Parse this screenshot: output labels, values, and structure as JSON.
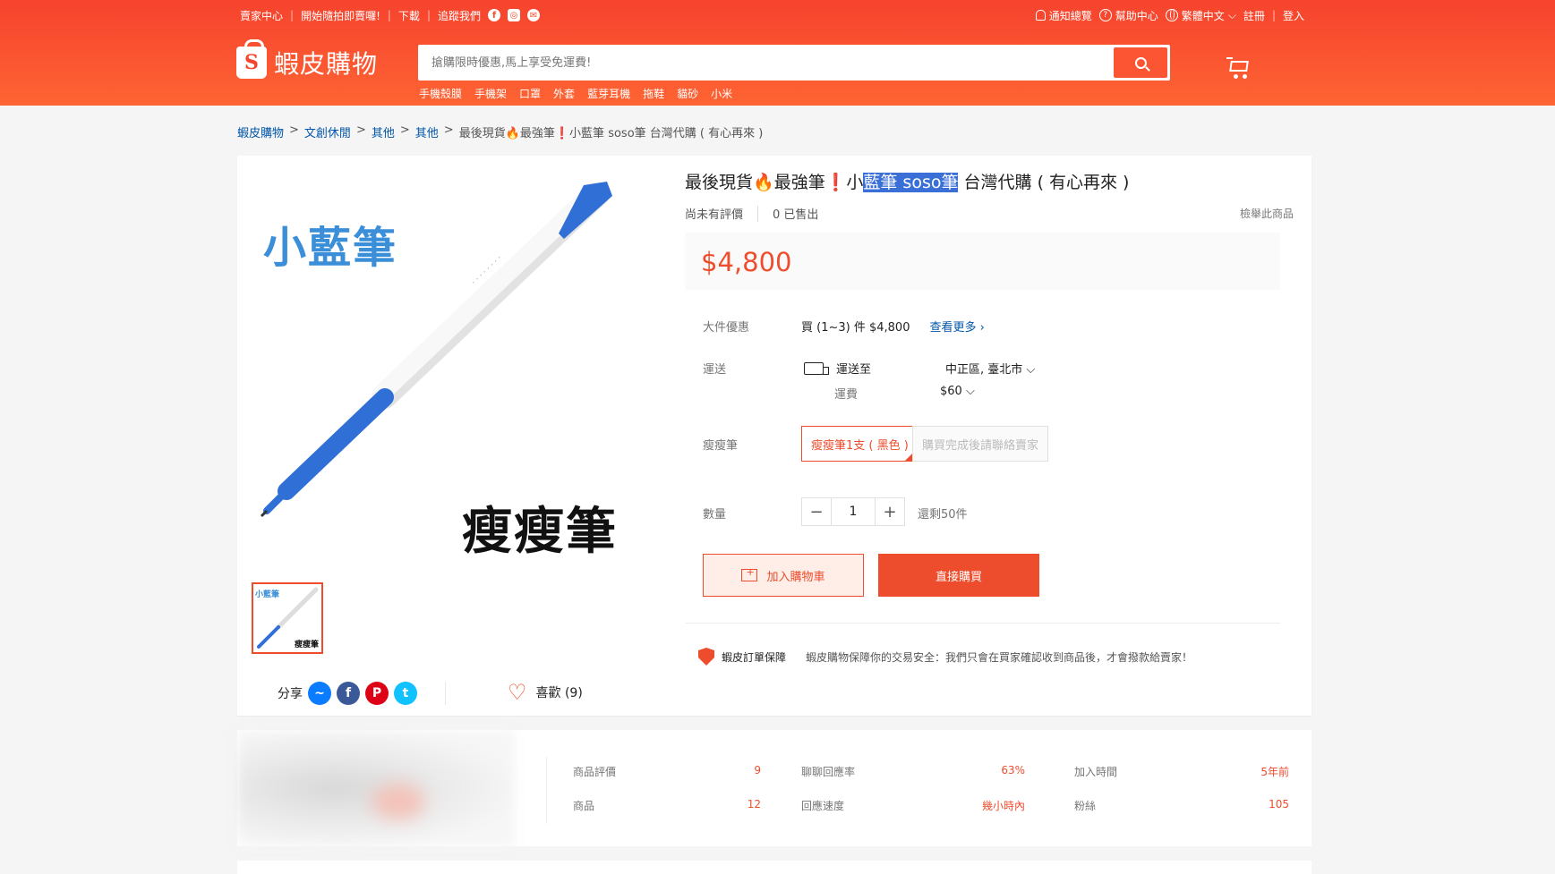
{
  "colors": {
    "brand": "#ee4d2d",
    "header": "#f6432e",
    "link": "#0055aa",
    "highlight": "#3b6fd8"
  },
  "topbar": {
    "left": [
      "賣家中心",
      "開始隨拍即賣囉!",
      "下載",
      "追蹤我們"
    ],
    "social": [
      "f",
      "◎",
      "✉"
    ],
    "right": [
      "通知總覽",
      "幫助中心",
      "繁體中文",
      "註冊",
      "登入"
    ]
  },
  "header": {
    "logo_text": "蝦皮購物",
    "search_placeholder": "搶購限時優惠,馬上享受免運費!",
    "hotwords": [
      "手機殼膜",
      "手機架",
      "口罩",
      "外套",
      "藍芽耳機",
      "拖鞋",
      "貓砂",
      "小米"
    ]
  },
  "breadcrumb": [
    "蝦皮購物",
    "文創休閒",
    "其他",
    "其他",
    "最後現貨🔥最強筆❗小藍筆 soso筆 台灣代購 ( 有心再來 )"
  ],
  "product": {
    "title_pre": "最後現貨",
    "title_flame": "🔥",
    "title_mid": "最強筆",
    "title_bang": "❗",
    "title_small": "小",
    "title_highlight": "藍筆 soso筆",
    "title_post": " 台灣代購 ( 有心再來 )",
    "rating": "尚未有評價",
    "sold": "0 已售出",
    "report": "檢舉此商品",
    "price": "$4,800",
    "image_caption_top": "小藍筆",
    "image_caption_bottom": "瘦瘦筆",
    "thumb_caption_top": "小藍筆",
    "thumb_caption_bottom": "瘦瘦筆"
  },
  "details": {
    "deal_label": "大件優惠",
    "deal_text": "買 (1~3) 件 $4,800",
    "deal_more": "查看更多 ›",
    "shipping_label": "運送",
    "shipping_to": "運送至",
    "shipping_dest": "中正區, 臺北市 ⌵",
    "shipping_fee_label": "運費",
    "shipping_fee": "$60 ⌵",
    "variant_label": "瘦瘦筆",
    "variant_selected": "瘦瘦筆1支 ( 黑色 )",
    "variant_disabled": "購買完成後請聯絡賣家",
    "qty_label": "數量",
    "qty_value": "1",
    "qty_minus": "−",
    "qty_plus": "+",
    "stock": "還剩50件",
    "add_to_cart": "加入購物車",
    "buy_now": "直接購買",
    "guarantee_title": "蝦皮訂單保障",
    "guarantee_desc": "蝦皮購物保障你的交易安全：我們只會在買家確認收到商品後，才會撥款給賣家！"
  },
  "social": {
    "share_label": "分享",
    "icons": [
      "messenger-icon",
      "facebook-icon",
      "pinterest-icon",
      "twitter-icon"
    ],
    "like_label": "喜歡 (9)"
  },
  "shop_stats": [
    {
      "label": "商品評價",
      "value": "9"
    },
    {
      "label": "聊聊回應率",
      "value": "63%"
    },
    {
      "label": "加入時間",
      "value": "5年前"
    },
    {
      "label": "商品",
      "value": "12"
    },
    {
      "label": "回應速度",
      "value": "幾小時內"
    },
    {
      "label": "粉絲",
      "value": "105"
    }
  ]
}
